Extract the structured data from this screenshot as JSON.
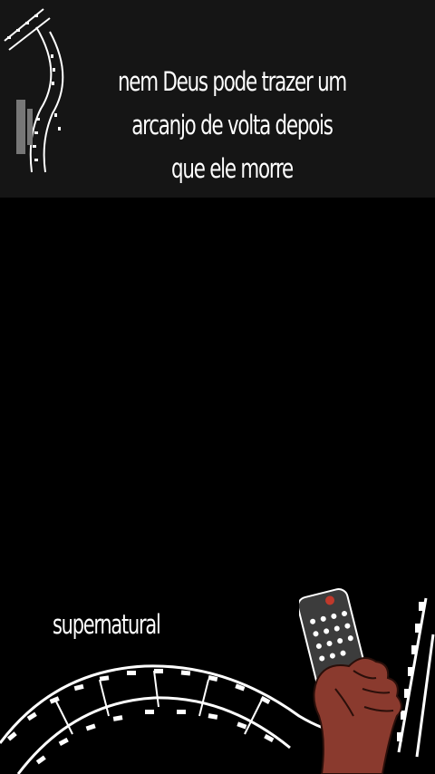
{
  "caption": {
    "lines": [
      "nem Deus pode trazer um",
      "arcanjo de volta depois",
      "que ele morre"
    ]
  },
  "bottom_label": "supernatural",
  "icons": {
    "filmstrip_top": "filmstrip-icon",
    "filmstrip_bottom": "filmstrip-icon",
    "remote": "tv-remote-icon"
  },
  "colors": {
    "background": "#000000",
    "panel": "#151515",
    "text": "#ffffff",
    "hand": "#8a3a2e",
    "remote": "#3c3c3c"
  }
}
